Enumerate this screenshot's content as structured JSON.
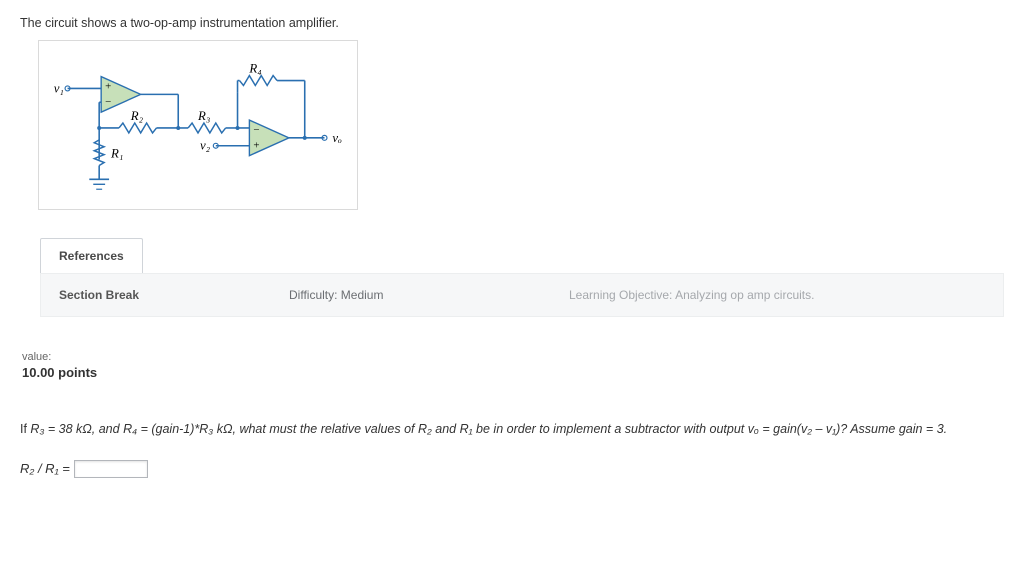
{
  "intro": "The circuit shows a two-op-amp instrumentation amplifier.",
  "circuit": {
    "v1": "v₁",
    "v2": "v₂",
    "vo": "vₒ",
    "R1": "R₁",
    "R2": "R₂",
    "R3": "R₃",
    "R4": "R₄"
  },
  "tabs": {
    "references": "References"
  },
  "section_row": {
    "section_break": "Section Break",
    "difficulty": "Difficulty: Medium",
    "learning_objective": "Learning Objective: Analyzing op amp circuits."
  },
  "value": {
    "label": "value:",
    "points": "10.00 points"
  },
  "question": {
    "prefix": "If ",
    "r3_eq": "R₃ = 38 kΩ, and ",
    "r4_eq": "R₄ = (gain-1)*R₃ kΩ, what must the relative values of ",
    "mid": "R₂ and R₁ be in order to implement a subtractor with output ",
    "vo_expr": "vₒ = gain(v₂ – v₁)? Assume gain = 3."
  },
  "answer": {
    "label": "R₂ / R₁ = "
  }
}
